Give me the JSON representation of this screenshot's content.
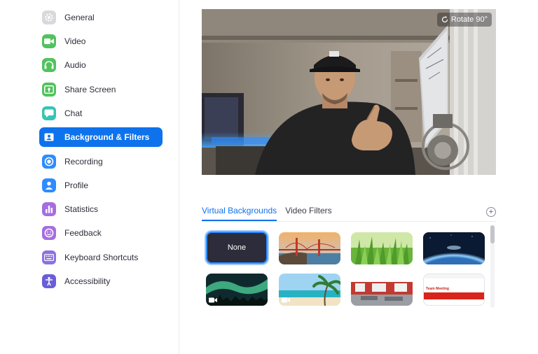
{
  "sidebar": {
    "items": [
      {
        "label": "General",
        "icon": "gear-icon",
        "color": "#d5d5d9",
        "active": false
      },
      {
        "label": "Video",
        "icon": "video-camera-icon",
        "color": "#51c35e",
        "active": false
      },
      {
        "label": "Audio",
        "icon": "headphones-icon",
        "color": "#51c35e",
        "active": false
      },
      {
        "label": "Share Screen",
        "icon": "share-screen-icon",
        "color": "#51c35e",
        "active": false
      },
      {
        "label": "Chat",
        "icon": "chat-bubble-icon",
        "color": "#35c4b5",
        "active": false
      },
      {
        "label": "Background & Filters",
        "icon": "background-portrait-icon",
        "color": "#0e72ed",
        "active": true
      },
      {
        "label": "Recording",
        "icon": "record-icon",
        "color": "#2d8cff",
        "active": false
      },
      {
        "label": "Profile",
        "icon": "person-icon",
        "color": "#2d8cff",
        "active": false
      },
      {
        "label": "Statistics",
        "icon": "bar-chart-icon",
        "color": "#a56ee0",
        "active": false
      },
      {
        "label": "Feedback",
        "icon": "smiley-icon",
        "color": "#a56ee0",
        "active": false
      },
      {
        "label": "Keyboard Shortcuts",
        "icon": "keyboard-icon",
        "color": "#8c71e2",
        "active": false
      },
      {
        "label": "Accessibility",
        "icon": "accessibility-icon",
        "color": "#6a5ed8",
        "active": false
      }
    ]
  },
  "preview": {
    "rotate_label": "Rotate 90°"
  },
  "tabs": {
    "virtual_backgrounds": "Virtual Backgrounds",
    "video_filters": "Video Filters"
  },
  "backgrounds": {
    "none_label": "None",
    "items": [
      {
        "name": "none",
        "selected": true
      },
      {
        "name": "golden-gate-bridge",
        "selected": false
      },
      {
        "name": "grass",
        "selected": false
      },
      {
        "name": "earth-from-space",
        "selected": false
      },
      {
        "name": "aurora",
        "selected": false
      },
      {
        "name": "beach",
        "selected": false
      },
      {
        "name": "office",
        "selected": false
      },
      {
        "name": "team-meeting",
        "selected": false
      }
    ],
    "team_meeting_title": "Team Meeting"
  },
  "colors": {
    "accent": "#0e72ed",
    "selected_ring": "#2d8cff"
  }
}
